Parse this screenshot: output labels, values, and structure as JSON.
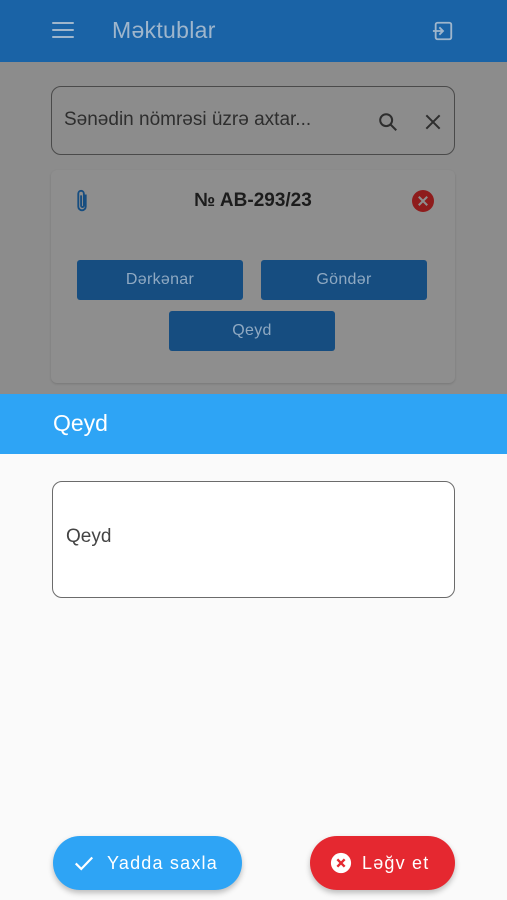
{
  "appbar": {
    "title": "Məktublar",
    "menu_icon": "menu-icon",
    "logout_icon": "logout-icon"
  },
  "search": {
    "placeholder": "Sənədin nömrəsi üzrə axtar...",
    "search_icon": "search-icon",
    "clear_icon": "close-icon"
  },
  "document_card": {
    "number": "№ AB-293/23",
    "attachment_icon": "paperclip-icon",
    "delete_icon": "delete-icon",
    "buttons": {
      "resolution": "Dərkənar",
      "send": "Göndər",
      "note": "Qeyd"
    }
  },
  "note_sheet": {
    "title": "Qeyd",
    "field": {
      "placeholder": "Qeyd",
      "value": ""
    },
    "save_label": "Yadda saxla",
    "cancel_label": "Ləğv et"
  },
  "colors": {
    "primary": "#2EA4F5",
    "danger": "#E52830",
    "appbar_dimmed": "#1A63A6"
  }
}
